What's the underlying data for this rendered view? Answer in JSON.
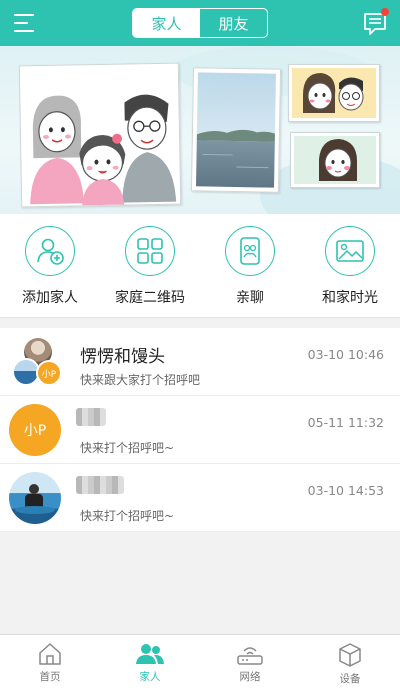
{
  "header": {
    "tabs": [
      {
        "label": "家人",
        "active": true
      },
      {
        "label": "朋友",
        "active": false
      }
    ],
    "has_unread_message": true
  },
  "actions": [
    {
      "label": "添加家人",
      "icon": "add-family-icon"
    },
    {
      "label": "家庭二维码",
      "icon": "qrcode-icon"
    },
    {
      "label": "亲聊",
      "icon": "chat-phone-icon"
    },
    {
      "label": "和家时光",
      "icon": "photo-album-icon"
    }
  ],
  "chats": [
    {
      "name": "愣愣和馒头",
      "preview": "快来跟大家打个招呼吧",
      "time": "03-10 10:46"
    },
    {
      "name": "",
      "preview": "快来打个招呼吧~",
      "time": "05-11 11:32",
      "avatar_text": "小P"
    },
    {
      "name": "",
      "preview": "快来打个招呼吧~",
      "time": "03-10 14:53"
    }
  ],
  "group_avatar_badge": "小P",
  "bottom_nav": [
    {
      "label": "首页",
      "active": false
    },
    {
      "label": "家人",
      "active": true
    },
    {
      "label": "网络",
      "active": false
    },
    {
      "label": "设备",
      "active": false
    }
  ],
  "colors": {
    "accent": "#2ec2b0",
    "badge": "#f5a623",
    "unread_dot": "#f44336"
  }
}
